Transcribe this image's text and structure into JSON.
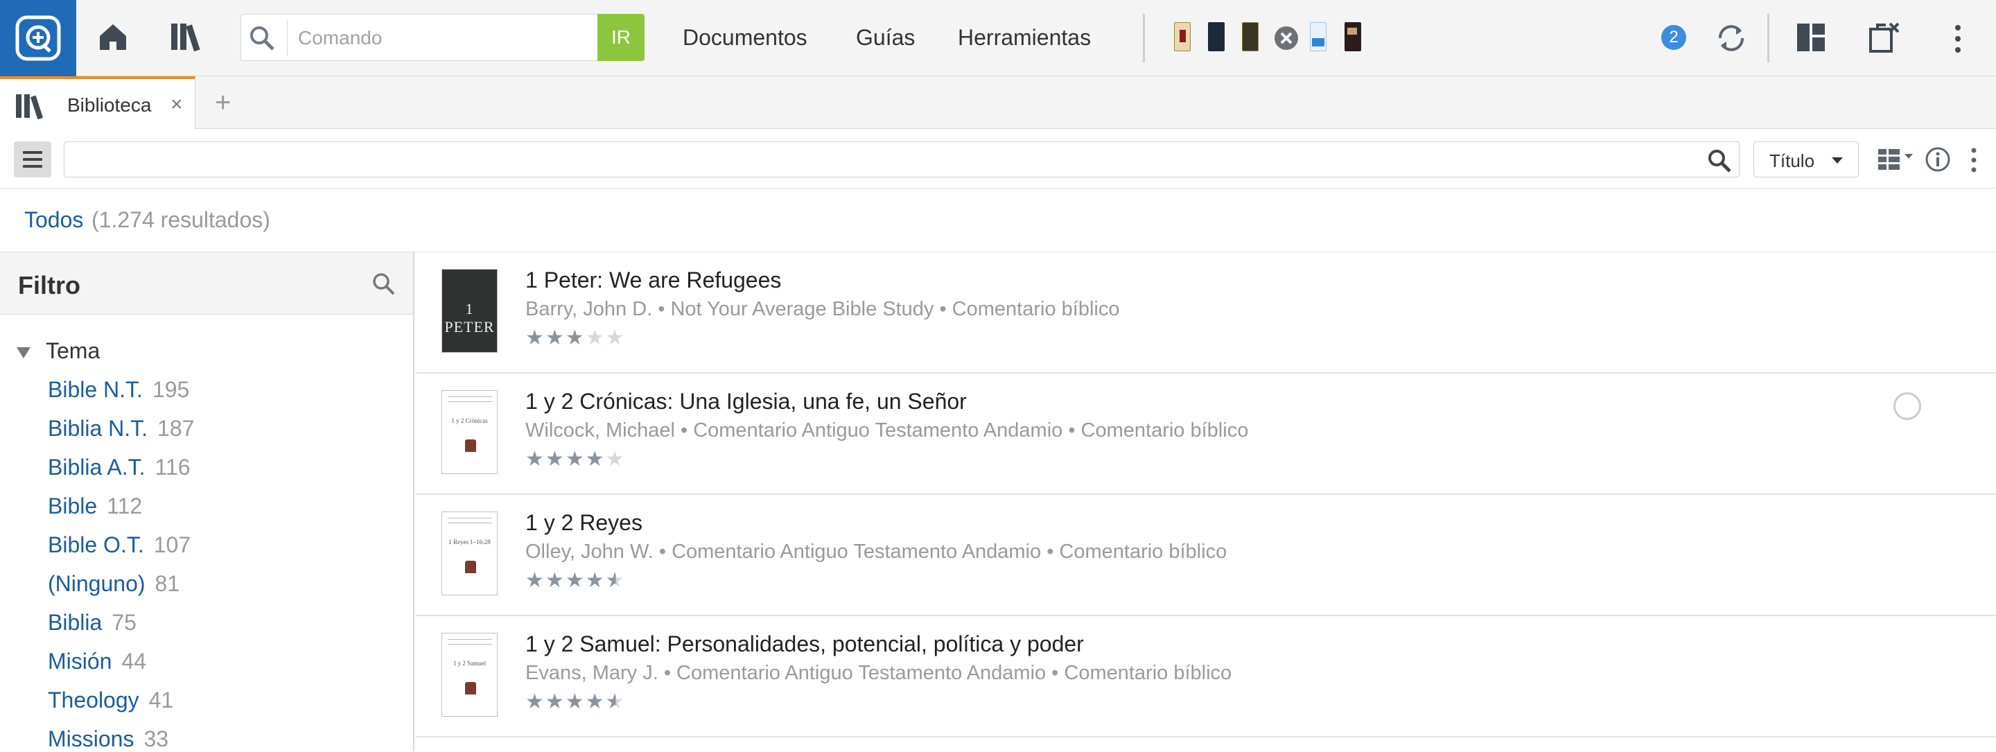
{
  "topbar": {
    "command_placeholder": "Comando",
    "go_label": "IR",
    "menus": [
      "Documentos",
      "Guías",
      "Herramientas"
    ],
    "notification_count": "2"
  },
  "tabs": [
    {
      "label": "Biblioteca",
      "close": "×"
    }
  ],
  "add_tab": "+",
  "library": {
    "search_value": "",
    "sort_value": "Título"
  },
  "results": {
    "all_label": "Todos",
    "count_label": "(1.274 resultados)"
  },
  "filter": {
    "title": "Filtro",
    "group": "Tema",
    "items": [
      {
        "name": "Bible N.T.",
        "count": "195"
      },
      {
        "name": "Biblia N.T.",
        "count": "187"
      },
      {
        "name": "Biblia A.T.",
        "count": "116"
      },
      {
        "name": "Bible",
        "count": "112"
      },
      {
        "name": "Bible O.T.",
        "count": "107"
      },
      {
        "name": "(Ninguno)",
        "count": "81"
      },
      {
        "name": "Biblia",
        "count": "75"
      },
      {
        "name": "Misión",
        "count": "44"
      },
      {
        "name": "Theology",
        "count": "41"
      },
      {
        "name": "Missions",
        "count": "33"
      }
    ]
  },
  "list": [
    {
      "title": "1 Peter: We are Refugees",
      "subtitle": "Barry, John D. • Not Your Average Bible Study • Comentario bíblico",
      "rating": 3,
      "cover_text": "1 PETER"
    },
    {
      "title": "1 y 2 Crónicas: Una Iglesia, una fe, un Señor",
      "subtitle": "Wilcock, Michael • Comentario Antiguo Testamento Andamio • Comentario bíblico",
      "rating": 4,
      "cover_text": "1 y 2 Crónicas"
    },
    {
      "title": "1 y 2 Reyes",
      "subtitle": "Olley, John W. • Comentario Antiguo Testamento Andamio • Comentario bíblico",
      "rating": 4.5,
      "cover_text": "1 Reyes 1–16:28"
    },
    {
      "title": "1 y 2 Samuel: Personalidades, potencial, política y poder",
      "subtitle": "Evans, Mary J. • Comentario Antiguo Testamento Andamio • Comentario bíblico",
      "rating": 4.5,
      "cover_text": "1 y 2 Samuel"
    }
  ],
  "colors": {
    "brand_blue": "#1f6bb8",
    "go_green": "#8cc63f",
    "tab_accent": "#f08a24",
    "link_blue": "#1a5c9e",
    "badge_blue": "#3b8de0"
  }
}
